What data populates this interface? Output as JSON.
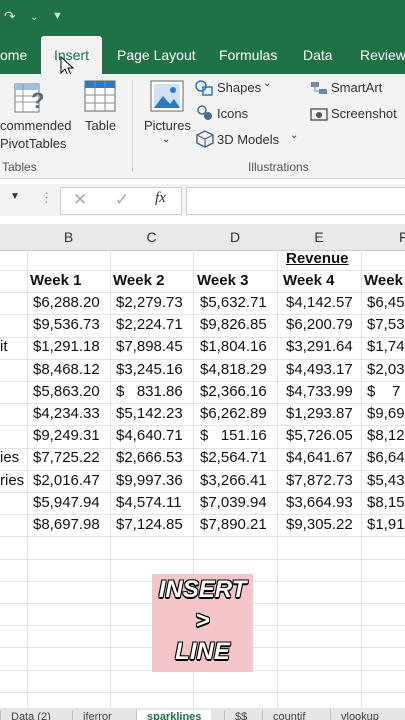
{
  "ribbon_tabs": [
    "ome",
    "Insert",
    "Page Layout",
    "Formulas",
    "Data",
    "Review"
  ],
  "ribbon": {
    "recommended_line1": "commended",
    "recommended_line2": "PivotTables",
    "table": "Table",
    "pictures": "Pictures",
    "shapes": "Shapes",
    "icons": "Icons",
    "models": "3D Models",
    "smartart": "SmartArt",
    "screenshot": "Screenshot",
    "group_tables": "Tables",
    "group_illustrations": "Illustrations"
  },
  "formula_bar": {
    "fx": "fx",
    "value": ""
  },
  "grid": {
    "columns": [
      "B",
      "C",
      "D",
      "E",
      "F"
    ],
    "header_label": "Revenue",
    "week_headers": [
      "Week 1",
      "Week 2",
      "Week 3",
      "Week 4",
      "Week"
    ],
    "row_labels": [
      "",
      "",
      "it",
      "",
      "",
      "",
      "",
      "ies",
      "ries",
      "",
      ""
    ],
    "rows": [
      [
        "$6,288.20",
        "$2,279.73",
        "$5,632.71",
        "$4,142.57",
        "$6,45"
      ],
      [
        "$9,536.73",
        "$2,224.71",
        "$9,826.85",
        "$6,200.79",
        "$7,53"
      ],
      [
        "$1,291.18",
        "$7,898.45",
        "$1,804.16",
        "$3,291.64",
        "$1,74"
      ],
      [
        "$8,468.12",
        "$3,245.16",
        "$4,818.29",
        "$4,493.17",
        "$2,03"
      ],
      [
        "$5,863.20",
        "$   831.86",
        "$2,366.16",
        "$4,733.99",
        "$    7"
      ],
      [
        "$4,234.33",
        "$5,142.23",
        "$6,262.89",
        "$1,293.87",
        "$9,69"
      ],
      [
        "$9,249.31",
        "$4,640.71",
        "$   151.16",
        "$5,726.05",
        "$8,12"
      ],
      [
        "$7,725.22",
        "$2,666.53",
        "$2,564.71",
        "$4,641.67",
        "$6,64"
      ],
      [
        "$2,016.47",
        "$9,997.36",
        "$3,266.41",
        "$7,872.73",
        "$5,43"
      ],
      [
        "$5,947.94",
        "$4,574.11",
        "$7,039.94",
        "$3,664.93",
        "$8,15"
      ],
      [
        "$8,697.98",
        "$7,124.85",
        "$7,890.21",
        "$9,305.22",
        "$1,91"
      ]
    ]
  },
  "overlay": {
    "line1": "INSERT",
    "line2": ">",
    "line3": "LINE"
  },
  "sheet_tabs": [
    "Data (2)",
    "iferror",
    "sparklines",
    "$$",
    "countif",
    "vlookup"
  ]
}
